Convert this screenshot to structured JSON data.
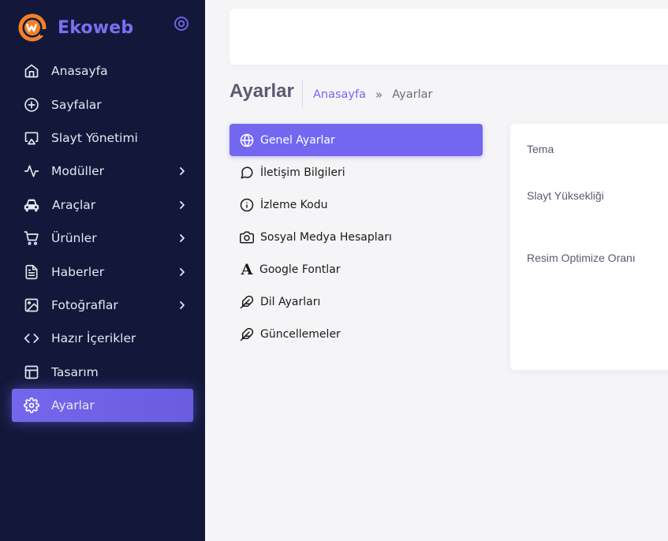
{
  "brand": {
    "name": "Ekoweb"
  },
  "sidebar": {
    "items": [
      {
        "label": "Anasayfa",
        "icon": "home-icon",
        "has_submenu": false
      },
      {
        "label": "Sayfalar",
        "icon": "plus-circle-icon",
        "has_submenu": false
      },
      {
        "label": "Slayt Yönetimi",
        "icon": "slideshow-icon",
        "has_submenu": false
      },
      {
        "label": "Modüller",
        "icon": "activity-icon",
        "has_submenu": true
      },
      {
        "label": "Araçlar",
        "icon": "car-icon",
        "has_submenu": true
      },
      {
        "label": "Ürünler",
        "icon": "cart-icon",
        "has_submenu": true
      },
      {
        "label": "Haberler",
        "icon": "file-text-icon",
        "has_submenu": true
      },
      {
        "label": "Fotoğraflar",
        "icon": "image-icon",
        "has_submenu": true
      },
      {
        "label": "Hazır İçerikler",
        "icon": "code-icon",
        "has_submenu": false
      },
      {
        "label": "Tasarım",
        "icon": "layout-icon",
        "has_submenu": false
      },
      {
        "label": "Ayarlar",
        "icon": "settings-icon",
        "has_submenu": false,
        "active": true
      }
    ]
  },
  "header": {
    "title": "Ayarlar",
    "breadcrumb": {
      "home": "Anasayfa",
      "separator": "»",
      "current": "Ayarlar"
    }
  },
  "settings_menu": {
    "items": [
      {
        "label": "Genel Ayarlar",
        "icon": "globe-icon",
        "active": true
      },
      {
        "label": "İletişim Bilgileri",
        "icon": "message-circle-icon"
      },
      {
        "label": "İzleme Kodu",
        "icon": "info-icon"
      },
      {
        "label": "Sosyal Medya Hesapları",
        "icon": "camera-icon"
      },
      {
        "label": "Google Fontlar",
        "icon": "font-icon"
      },
      {
        "label": "Dil Ayarları",
        "icon": "feather-icon"
      },
      {
        "label": "Güncellemeler",
        "icon": "feather-icon"
      }
    ]
  },
  "panel": {
    "fields": [
      {
        "label": "Tema"
      },
      {
        "label": "Slayt Yüksekliği"
      },
      {
        "label": "Resim Optimize Oranı"
      }
    ]
  },
  "colors": {
    "sidebar_bg": "#13183a",
    "accent": "#7367f0",
    "brand_orange": "#f0812b",
    "page_bg": "#f5f5f7"
  }
}
